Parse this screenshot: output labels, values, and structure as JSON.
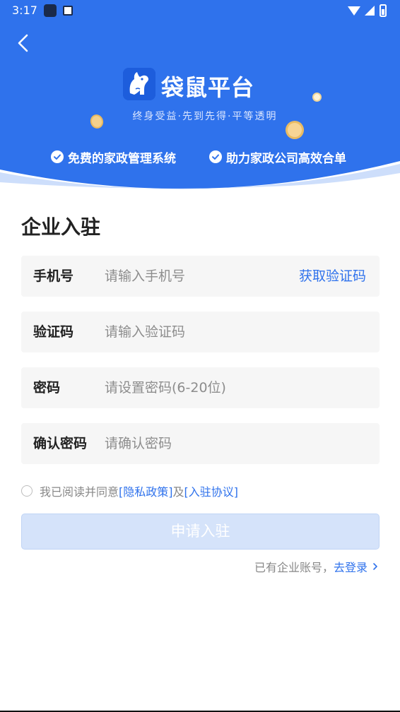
{
  "status_bar": {
    "time": "3:17"
  },
  "header": {
    "brand_name": "袋鼠平台",
    "slogan": "终身受益·先到先得·平等透明",
    "features": [
      "免费的家政管理系统",
      "助力家政公司高效合单"
    ]
  },
  "page_title": "企业入驻",
  "form": {
    "phone": {
      "label": "手机号",
      "placeholder": "请输入手机号",
      "action": "获取验证码"
    },
    "code": {
      "label": "验证码",
      "placeholder": "请输入验证码"
    },
    "password": {
      "label": "密码",
      "placeholder": "请设置密码(6-20位)"
    },
    "confirm": {
      "label": "确认密码",
      "placeholder": "请确认密码"
    }
  },
  "agreement": {
    "prefix": "我已阅读并同意",
    "privacy": "[隐私政策]",
    "conj": "及",
    "terms": "[入驻协议]"
  },
  "submit_label": "申请入驻",
  "login": {
    "prefix": "已有企业账号，",
    "link": "去登录"
  },
  "colors": {
    "primary": "#2f72ec",
    "submit_disabled": "#d5e3fa"
  }
}
